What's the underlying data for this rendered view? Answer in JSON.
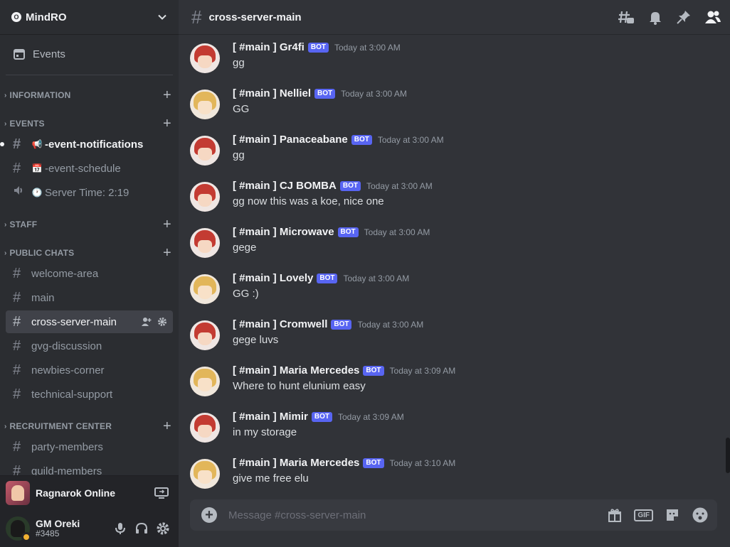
{
  "server": {
    "name": "MindRO",
    "logo_glyph": "O"
  },
  "sidebar": {
    "events_label": "Events",
    "categories": [
      {
        "label": "INFORMATION"
      },
      {
        "label": "EVENTS"
      },
      {
        "label": "STAFF"
      },
      {
        "label": "PUBLIC CHATS"
      },
      {
        "label": "RECRUITMENT CENTER"
      }
    ],
    "event_channels": [
      {
        "emoji": "📢",
        "label": "-event-notifications"
      },
      {
        "emoji": "📅",
        "label": "-event-schedule"
      },
      {
        "emoji": "🕐",
        "label": "Server Time: 2:19"
      }
    ],
    "public_channels": [
      {
        "label": "welcome-area"
      },
      {
        "label": "main"
      },
      {
        "label": "cross-server-main"
      },
      {
        "label": "gvg-discussion"
      },
      {
        "label": "newbies-corner"
      },
      {
        "label": "technical-support"
      }
    ],
    "recruitment_channels": [
      {
        "label": "party-members"
      },
      {
        "label": "guild-members"
      }
    ]
  },
  "activity": {
    "game": "Ragnarok Online"
  },
  "user": {
    "name": "GM Oreki",
    "tag": "#3485"
  },
  "channel": {
    "title": "cross-server-main"
  },
  "messages": [
    {
      "author": "[ #main ] Gr4fi",
      "badge": "BOT",
      "time": "Today at 3:00 AM",
      "text": "gg",
      "avatar": "red"
    },
    {
      "author": "[ #main ] Nelliel",
      "badge": "BOT",
      "time": "Today at 3:00 AM",
      "text": "GG",
      "avatar": "blonde"
    },
    {
      "author": "[ #main ] Panaceabane",
      "badge": "BOT",
      "time": "Today at 3:00 AM",
      "text": "gg",
      "avatar": "red"
    },
    {
      "author": "[ #main ] CJ BOMBA",
      "badge": "BOT",
      "time": "Today at 3:00 AM",
      "text": "gg now this was a koe, nice one",
      "avatar": "red"
    },
    {
      "author": "[ #main ] Microwave",
      "badge": "BOT",
      "time": "Today at 3:00 AM",
      "text": "gege",
      "avatar": "red"
    },
    {
      "author": "[ #main ] Lovely",
      "badge": "BOT",
      "time": "Today at 3:00 AM",
      "text": "GG :)",
      "avatar": "blonde"
    },
    {
      "author": "[ #main ] Cromwell",
      "badge": "BOT",
      "time": "Today at 3:00 AM",
      "text": "gege luvs",
      "avatar": "red"
    },
    {
      "author": "[ #main ] Maria Mercedes",
      "badge": "BOT",
      "time": "Today at 3:09 AM",
      "text": "Where to hunt elunium easy",
      "avatar": "blonde"
    },
    {
      "author": "[ #main ] Mimir",
      "badge": "BOT",
      "time": "Today at 3:09 AM",
      "text": "in my storage",
      "avatar": "red"
    },
    {
      "author": "[ #main ] Maria Mercedes",
      "badge": "BOT",
      "time": "Today at 3:10 AM",
      "text": "give me free elu",
      "avatar": "blonde"
    }
  ],
  "composer": {
    "placeholder": "Message #cross-server-main",
    "gif_label": "GIF"
  },
  "colors": {
    "background": "#313338",
    "sidebar": "#2b2d31",
    "accent": "#5865f2",
    "selected": "#404249"
  }
}
